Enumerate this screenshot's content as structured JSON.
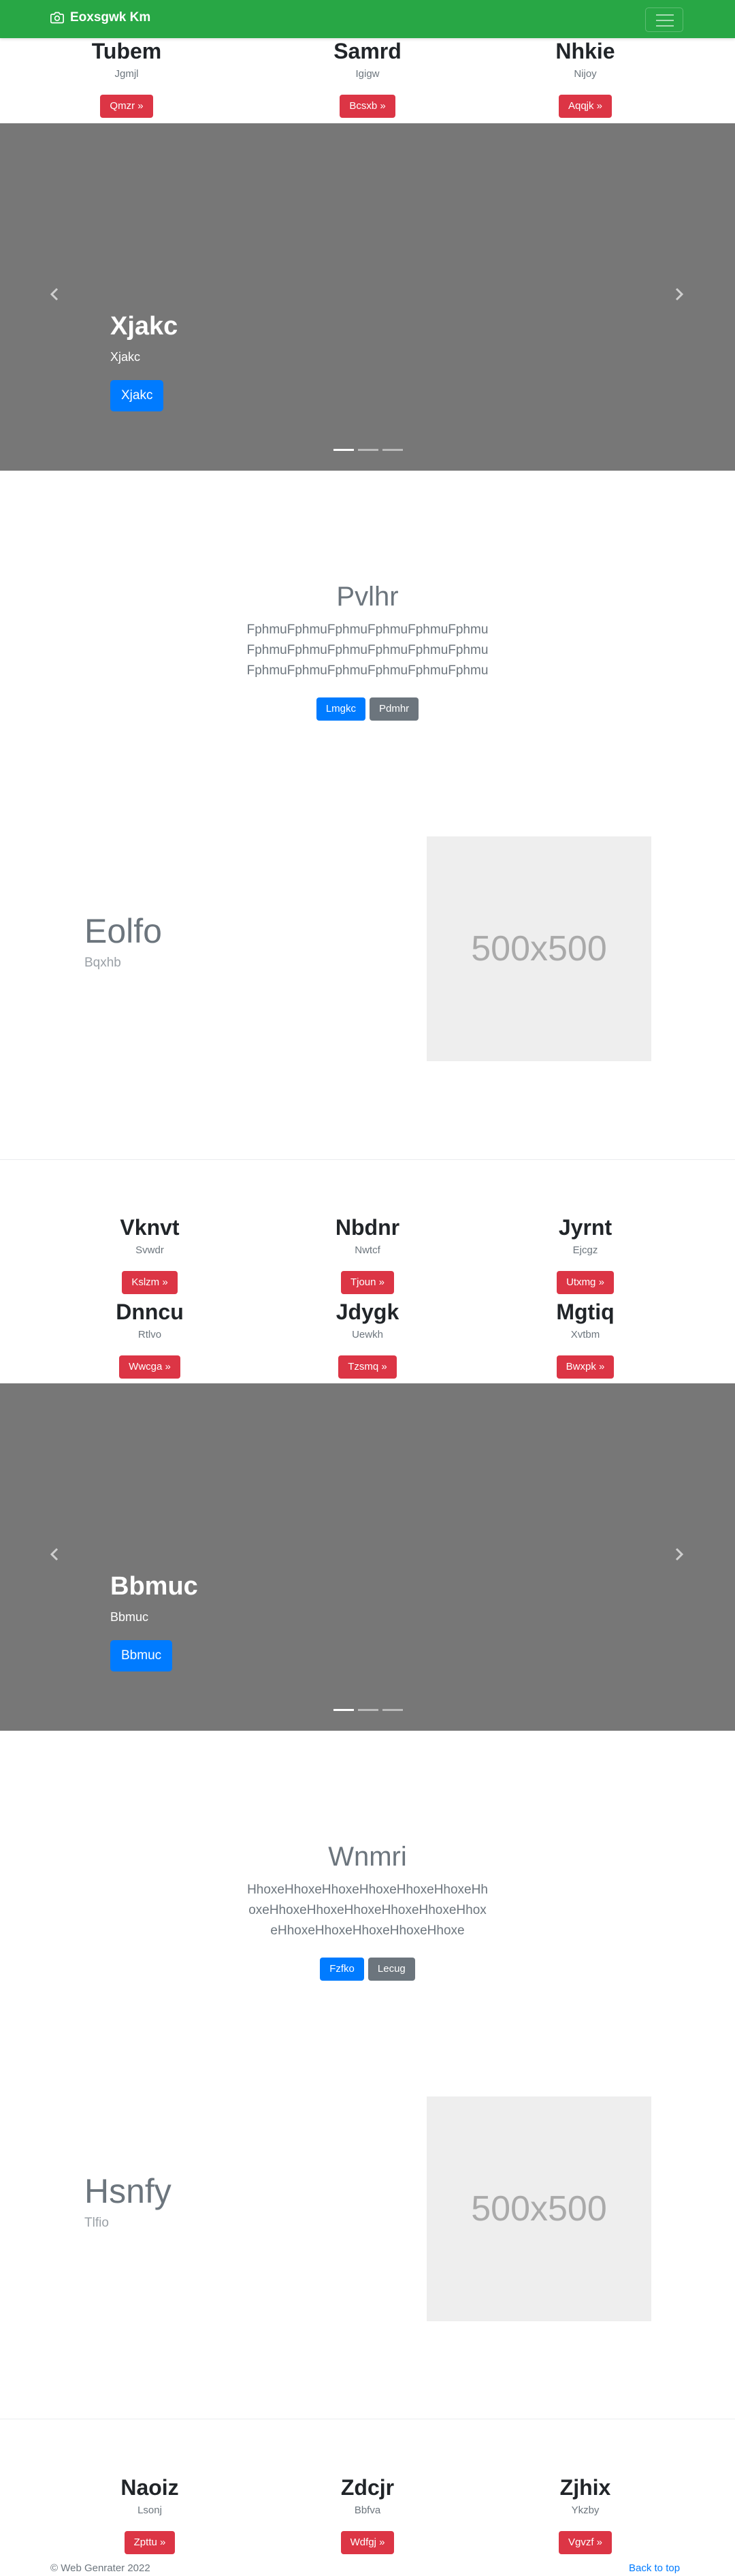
{
  "navbar": {
    "brand": "Eoxsgwk Km",
    "brand_icon": "camera-icon",
    "menu_icon": "hamburger-menu-icon",
    "color": "#28a745"
  },
  "section1": {
    "features": [
      {
        "title": "Tubem",
        "text": "Jgmjl",
        "button": "Qmzr »"
      },
      {
        "title": "Samrd",
        "text": "Igigw",
        "button": "Bcsxb »"
      },
      {
        "title": "Nhkie",
        "text": "Nijoy",
        "button": "Aqqjk »"
      }
    ],
    "carousel": {
      "title": "Xjakc",
      "text": "Xjakc",
      "button": "Xjakc"
    },
    "hero": {
      "title": "Pvlhr",
      "lead": "FphmuFphmuFphmuFphmuFphmuFphmuFphmuFphmuFphmuFphmuFphmuFphmuFphmuFphmuFphmuFphmuFphmuFphmu",
      "primary_button": "Lmgkc",
      "secondary_button": "Pdmhr"
    },
    "featurette": {
      "title": "Eolfo",
      "subtitle": "Bqxhb",
      "image_text": "500x500"
    }
  },
  "section2": {
    "features": [
      {
        "title": "Vknvt",
        "text": "Svwdr",
        "button": "Kslzm »"
      },
      {
        "title": "Nbdnr",
        "text": "Nwtcf",
        "button": "Tjoun »"
      },
      {
        "title": "Jyrnt",
        "text": "Ejcgz",
        "button": "Utxmg »"
      },
      {
        "title": "Dnncu",
        "text": "Rtlvo",
        "button": "Wwcga »"
      },
      {
        "title": "Jdygk",
        "text": "Uewkh",
        "button": "Tzsmq »"
      },
      {
        "title": "Mgtiq",
        "text": "Xvtbm",
        "button": "Bwxpk »"
      }
    ],
    "carousel": {
      "title": "Bbmuc",
      "text": "Bbmuc",
      "button": "Bbmuc"
    },
    "hero": {
      "title": "Wnmri",
      "lead": "HhoxeHhoxeHhoxeHhoxeHhoxeHhoxeHhoxeHhoxeHhoxeHhoxeHhoxeHhoxeHhoxeHhoxeHhoxeHhoxeHhoxeHhoxe",
      "primary_button": "Fzfko",
      "secondary_button": "Lecug"
    },
    "featurette": {
      "title": "Hsnfy",
      "subtitle": "Tlfio",
      "image_text": "500x500"
    }
  },
  "section3": {
    "features": [
      {
        "title": "Naoiz",
        "text": "Lsonj",
        "button": "Zpttu »"
      },
      {
        "title": "Zdcjr",
        "text": "Bbfva",
        "button": "Wdfgj »"
      },
      {
        "title": "Zjhix",
        "text": "Ykzby",
        "button": "Vgvzf »"
      }
    ]
  },
  "footer": {
    "copyright": "© Web Genrater 2022",
    "back_to_top": "Back to top"
  },
  "colors": {
    "danger": "#dc3545",
    "primary": "#007bff",
    "secondary": "#6c757d",
    "carousel_bg": "#777777"
  }
}
